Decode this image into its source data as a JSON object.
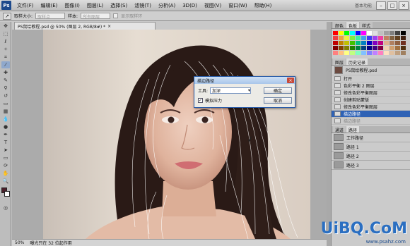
{
  "app": {
    "logo": "Ps",
    "workspace_label": "基本功能"
  },
  "menu": [
    "文件(F)",
    "编辑(E)",
    "图像(I)",
    "图层(L)",
    "选择(S)",
    "滤镜(T)",
    "分析(A)",
    "3D(D)",
    "视图(V)",
    "窗口(W)",
    "帮助(H)"
  ],
  "window_controls": {
    "minimize": "–",
    "maximize": "□",
    "close": "×"
  },
  "options_bar": {
    "tool_icon": "↗",
    "sample_label": "取样大小:",
    "sample_value": "取样点",
    "style_label": "样本:",
    "style_value": "所有图层",
    "ring_label": "显示取样环"
  },
  "document": {
    "tab_title": "PS鼠绘教程.psd @ 50% (图层 2, RGB/8#) *",
    "tab_close": "×"
  },
  "status": {
    "zoom": "50%",
    "info": "曝光只在 32 位起作用"
  },
  "dialog": {
    "title": "描边路径",
    "close": "×",
    "tool_label": "工具:",
    "tool_value": "加深",
    "ok": "确定",
    "cancel": "取消",
    "simulate_pressure_label": "模拟压力",
    "simulate_pressure_checked": true
  },
  "panels": {
    "swatch_tabs": [
      "颜色",
      "色板",
      "样式"
    ],
    "history_tabs": [
      "图层",
      "历史记录"
    ],
    "history_doc": "PS鼠绘教程.psd",
    "history_items": [
      "打开",
      "色彩平衡 2 图层",
      "修改色彩平衡图层",
      "创建剪贴蒙版",
      "修改色彩平衡图层",
      "描边路径",
      "描边路径"
    ],
    "history_selected_index": 5,
    "path_tabs": [
      "通道",
      "路径"
    ],
    "paths": [
      "工作路径",
      "路径 1",
      "路径 2",
      "路径 3"
    ]
  },
  "watermark": {
    "main": "UiBQ.CoM",
    "sub": "www.psahz.com"
  },
  "colors": {
    "accent": "#2f62b5",
    "dialog_border": "#2a5ca8"
  }
}
